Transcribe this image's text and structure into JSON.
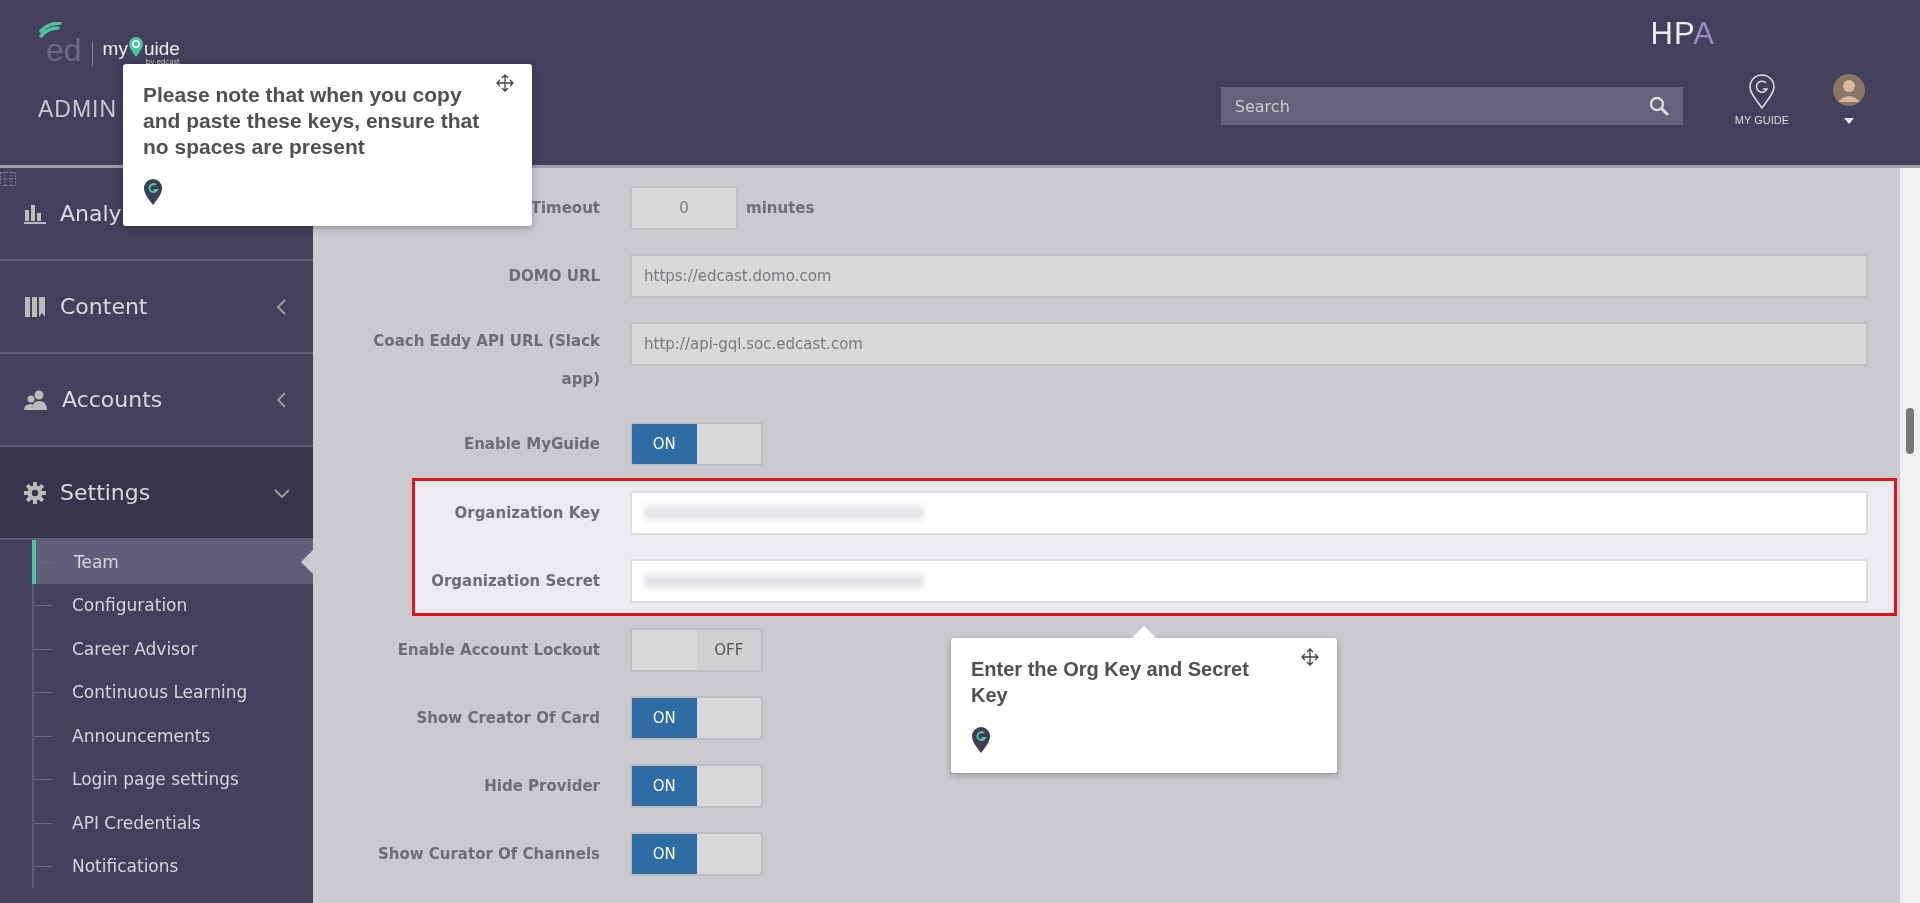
{
  "header": {
    "logo": {
      "mark": "ed",
      "product_start": "my",
      "product_end": "uide",
      "byline": "by edcast"
    },
    "section": "ADMIN",
    "brand": "HPA",
    "search": {
      "placeholder": "Search"
    },
    "guide_label": "MY GUIDE"
  },
  "sidebar": {
    "items": [
      {
        "label": "Analy",
        "kind": "chart",
        "expanded": false
      },
      {
        "label": "Content",
        "kind": "books",
        "expanded": false
      },
      {
        "label": "Accounts",
        "kind": "people",
        "expanded": false
      },
      {
        "label": "Settings",
        "kind": "gear",
        "expanded": true,
        "children": [
          {
            "label": "Team",
            "selected": true
          },
          {
            "label": "Configuration",
            "selected": false
          },
          {
            "label": "Career Advisor",
            "selected": false
          },
          {
            "label": "Continuous Learning",
            "selected": false
          },
          {
            "label": "Announcements",
            "selected": false
          },
          {
            "label": "Login page settings",
            "selected": false
          },
          {
            "label": "API Credentials",
            "selected": false
          },
          {
            "label": "Notifications",
            "selected": false
          }
        ]
      }
    ]
  },
  "form": {
    "rows": [
      {
        "kind": "number",
        "label": "Timeout",
        "value": "0",
        "unit": "minutes"
      },
      {
        "kind": "text",
        "label": "DOMO URL",
        "value": "https://edcast.domo.com"
      },
      {
        "kind": "text",
        "label": "Coach Eddy API URL (Slack app)",
        "value": "http://api-gql.soc.edcast.com"
      },
      {
        "kind": "toggle",
        "label": "Enable MyGuide",
        "on": true,
        "state_label": "ON"
      },
      {
        "kind": "group",
        "highlighted": true,
        "rows": [
          {
            "kind": "masked",
            "label": "Organization Key"
          },
          {
            "kind": "masked",
            "label": "Organization Secret"
          }
        ]
      },
      {
        "kind": "toggle",
        "label": "Enable Account Lockout",
        "on": false,
        "state_label": "OFF"
      },
      {
        "kind": "toggle",
        "label": "Show Creator Of Card",
        "on": true,
        "state_label": "ON"
      },
      {
        "kind": "toggle",
        "label": "Hide Provider",
        "on": true,
        "state_label": "ON"
      },
      {
        "kind": "toggle",
        "label": "Show Curator Of Channels",
        "on": true,
        "state_label": "ON"
      }
    ]
  },
  "tooltips": [
    {
      "text": "Please note that when you copy and paste these keys, ensure that no spaces are present",
      "pointer": false
    },
    {
      "text": "Enter the Org Key and Secret Key",
      "pointer": true
    }
  ]
}
